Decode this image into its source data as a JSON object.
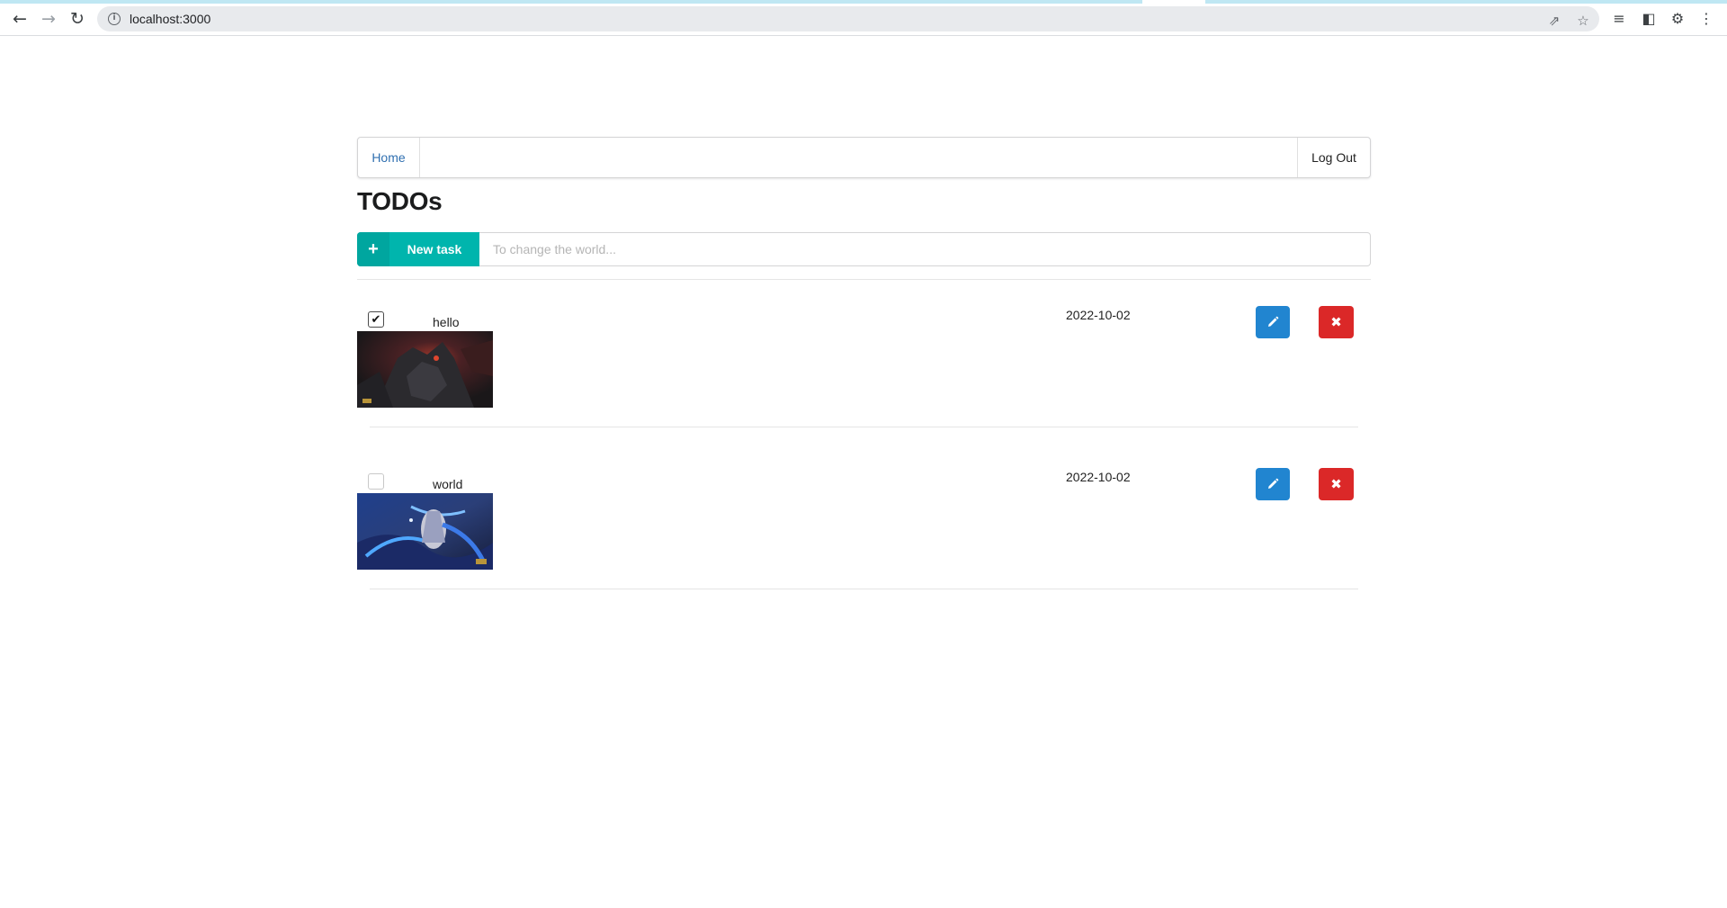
{
  "browser": {
    "url": "localhost:3000",
    "icons": [
      "back-icon",
      "forward-icon",
      "reload-icon",
      "info-icon",
      "share-icon",
      "star-icon",
      "media-icon",
      "side-panel-icon",
      "extension-icon",
      "menu-icon"
    ]
  },
  "navbar": {
    "home_label": "Home",
    "logout_label": "Log Out"
  },
  "page": {
    "title": "TODOs"
  },
  "new_task": {
    "button_label": "New task",
    "placeholder": "To change the world...",
    "value": ""
  },
  "todos": [
    {
      "name": "hello",
      "date": "2022-10-02",
      "completed": true
    },
    {
      "name": "world",
      "date": "2022-10-02",
      "completed": false
    }
  ],
  "colors": {
    "teal": "#00b5ad",
    "blue": "#2185d0",
    "red": "#db2828",
    "link": "#2f6fb0"
  }
}
